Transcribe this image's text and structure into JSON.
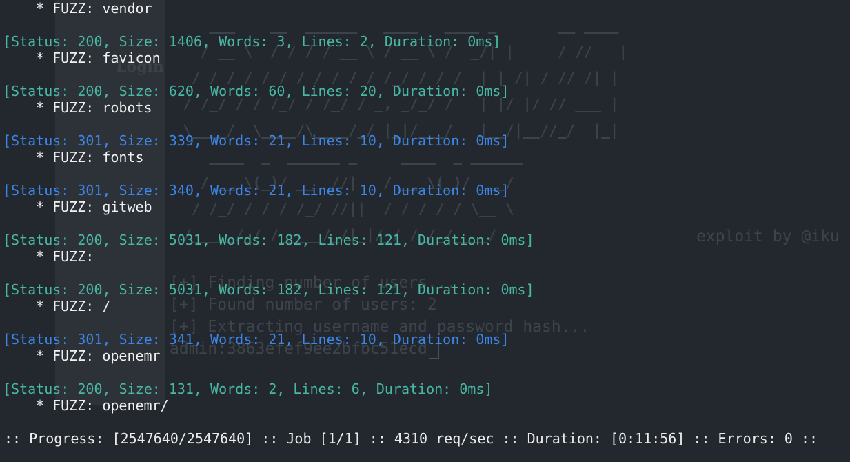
{
  "background_window": {
    "title": "Login",
    "ascii_art": [
      "     ___    __  ______   ____   ____ _       __ ____",
      "    / __ \\  / / / / __ \\ / __ \\ /  _/| |     / //   |",
      "   / / / / / / / / / / / /_/ / / /  | | /| / // /| |",
      "  / /_/ / / /_/ / /_/ / _, _/_/ /   | |/ |/ // ___ |",
      "  \\____/  \\____/\\____/_/ |_|/___/   |__/|__//_/  |_|",
      "     ____  _  ______ _     ____  _ ______",
      "    / __ \\(_)/ __  //|   / __ \\(_)/ ___/",
      "   / /_/ / / / /_/ //||  / / / / / \\__ \\",
      "  /_____/_/ /_____/_/|_|/_/ /_/_/____/"
    ],
    "credit": "exploit by @iku",
    "lines": [
      "[+] Finding number of users...",
      "[+] Found number of users: 2",
      "[+] Extracting username and password hash...",
      "admin:3863efef9ee2bfbc51ecd"
    ]
  },
  "results": [
    {
      "fuzz": "vendor"
    },
    {
      "status": "[Status: 200, Size: 1406, Words: 3, Lines: 2, Duration: 0ms]",
      "code": 200,
      "fuzz": "favicon"
    },
    {
      "status": "[Status: 200, Size: 620, Words: 60, Lines: 20, Duration: 0ms]",
      "code": 200,
      "fuzz": "robots"
    },
    {
      "status": "[Status: 301, Size: 339, Words: 21, Lines: 10, Duration: 0ms]",
      "code": 301,
      "fuzz": "fonts"
    },
    {
      "status": "[Status: 301, Size: 340, Words: 21, Lines: 10, Duration: 0ms]",
      "code": 301,
      "fuzz": "gitweb"
    },
    {
      "status": "[Status: 200, Size: 5031, Words: 182, Lines: 121, Duration: 0ms]",
      "code": 200,
      "fuzz": ""
    },
    {
      "status": "[Status: 200, Size: 5031, Words: 182, Lines: 121, Duration: 0ms]",
      "code": 200,
      "fuzz": "/"
    },
    {
      "status": "[Status: 301, Size: 341, Words: 21, Lines: 10, Duration: 0ms]",
      "code": 301,
      "fuzz": "openemr"
    },
    {
      "status": "[Status: 200, Size: 131, Words: 2, Lines: 6, Duration: 0ms]",
      "code": 200,
      "fuzz": "openemr/"
    }
  ],
  "fuzz_prefix": "* FUZZ: ",
  "progress_line": ":: Progress: [2547640/2547640] :: Job [1/1] :: 4310 req/sec :: Duration: [0:11:56] :: Errors: 0 ::",
  "colors": {
    "background": "#23282e",
    "status_200": "#48b8a4",
    "status_301": "#3d86e9",
    "fuzz_text": "#f0f0f0"
  }
}
